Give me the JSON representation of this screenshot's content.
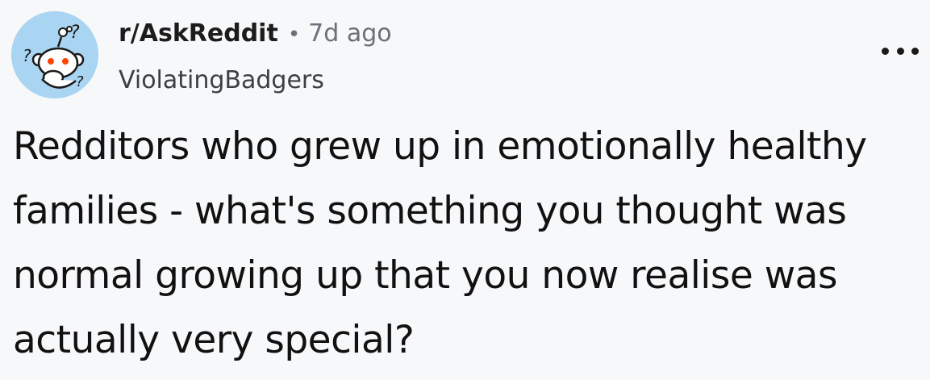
{
  "header": {
    "avatar_icon": "reddit-snoo-question-icon",
    "subreddit": "r/AskReddit",
    "separator": "•",
    "time_ago": "7d ago",
    "username": "ViolatingBadgers",
    "more_icon": "ellipsis-horizontal-icon"
  },
  "post": {
    "title": "Redditors who grew up in emotionally healthy families - what's something you thought was normal growing up that you now realise was actually very special?"
  },
  "colors": {
    "background": "#f7f8fa",
    "avatar_bg": "#a9d4f2",
    "text_primary": "#111111",
    "text_secondary": "#6b7178",
    "snoo_eye": "#ff4500"
  }
}
